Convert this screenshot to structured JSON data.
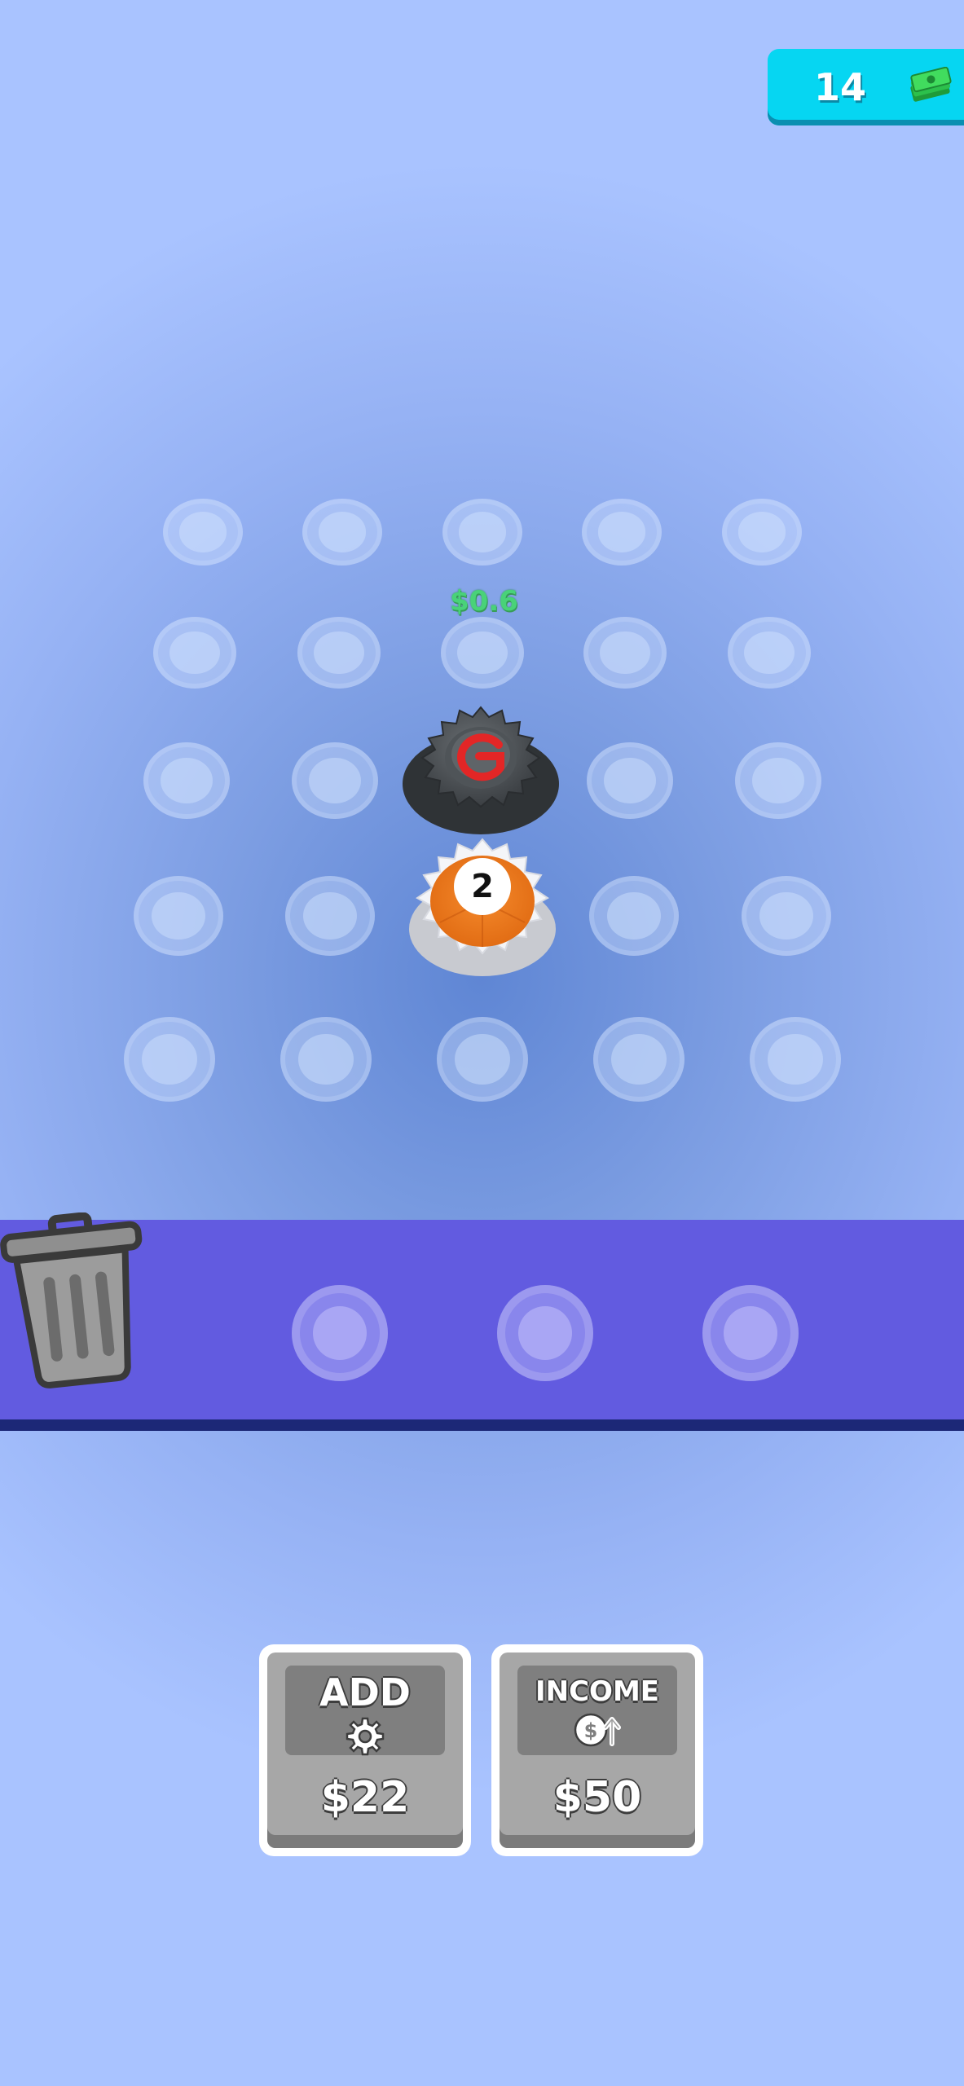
{
  "hud": {
    "money": "14",
    "money_icon": "cash-stack-icon"
  },
  "board": {
    "floating_income": "$0.6",
    "pegs_total": 25
  },
  "gears": {
    "top_gear_icon": "power-gear-icon",
    "bottom_gear_level": "2"
  },
  "tray": {
    "trash_icon": "trash-can-icon",
    "slots": 3
  },
  "shop": {
    "add": {
      "title": "ADD",
      "icon": "gear-icon",
      "price": "$22"
    },
    "income": {
      "title": "INCOME",
      "icon": "dollar-up-icon",
      "price": "$50"
    }
  },
  "colors": {
    "money_badge": "#06d6f2",
    "tray": "#625be0",
    "income_text": "#49d279",
    "gear_orange": "#f07d25"
  }
}
